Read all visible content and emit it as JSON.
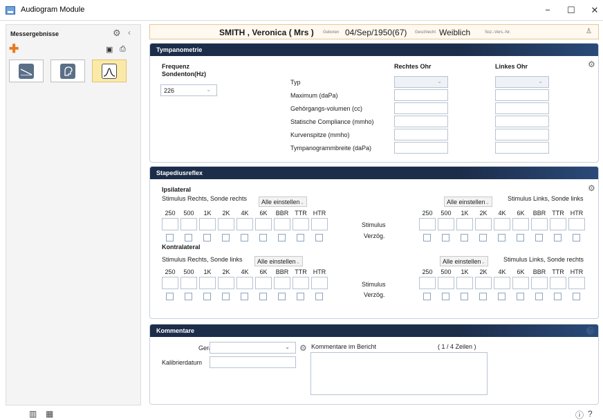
{
  "window": {
    "title": "Audiogram Module",
    "min": "−",
    "max": "☐",
    "close": "✕"
  },
  "sidebar": {
    "title": "Messergebnisse"
  },
  "patient": {
    "name": "SMITH , Veronica ( Mrs )",
    "born_label": "Geboren",
    "born_value": "04/Sep/1950(67)",
    "sex_label": "Geschlecht",
    "sex_value": "Weiblich",
    "ssn_label": "Soz.-Vers.-Nr."
  },
  "tymp": {
    "title": "Tympanometrie",
    "freq_label_1": "Frequenz",
    "freq_label_2": "Sondenton(Hz)",
    "freq_value": "226",
    "right_ear": "Rechtes Ohr",
    "left_ear": "Linkes Ohr",
    "rows": [
      "Typ",
      "Maximum (daPa)",
      "Gehörgangs-volumen (cc)",
      "Statische Compliance (mmho)",
      "Kurvenspitze (mmho)",
      "Tympanogrammbreite (daPa)"
    ]
  },
  "stap": {
    "title": "Stapediusreflex",
    "ipsi": "Ipsilateral",
    "kontra": "Kontralateral",
    "ipsi_right_stim": "Stimulus Rechts,  Sonde rechts",
    "ipsi_left_stim": "Stimulus Links,  Sonde links",
    "kontra_right_stim": "Stimulus Rechts,  Sonde links",
    "kontra_left_stim": "Stimulus Links,  Sonde rechts",
    "set_all": "Alle einstellen",
    "stimulus": "Stimulus",
    "delay": "Verzög.",
    "freqs": [
      "250",
      "500",
      "1K",
      "2K",
      "4K",
      "6K",
      "BBR",
      "TTR",
      "HTR"
    ]
  },
  "komm": {
    "title": "Kommentare",
    "device_label": "Gerät",
    "calib_label": "Kalibrierdatum",
    "report_label": "Kommentare im Bericht",
    "lines": "( 1 / 4 Zeilen )"
  }
}
